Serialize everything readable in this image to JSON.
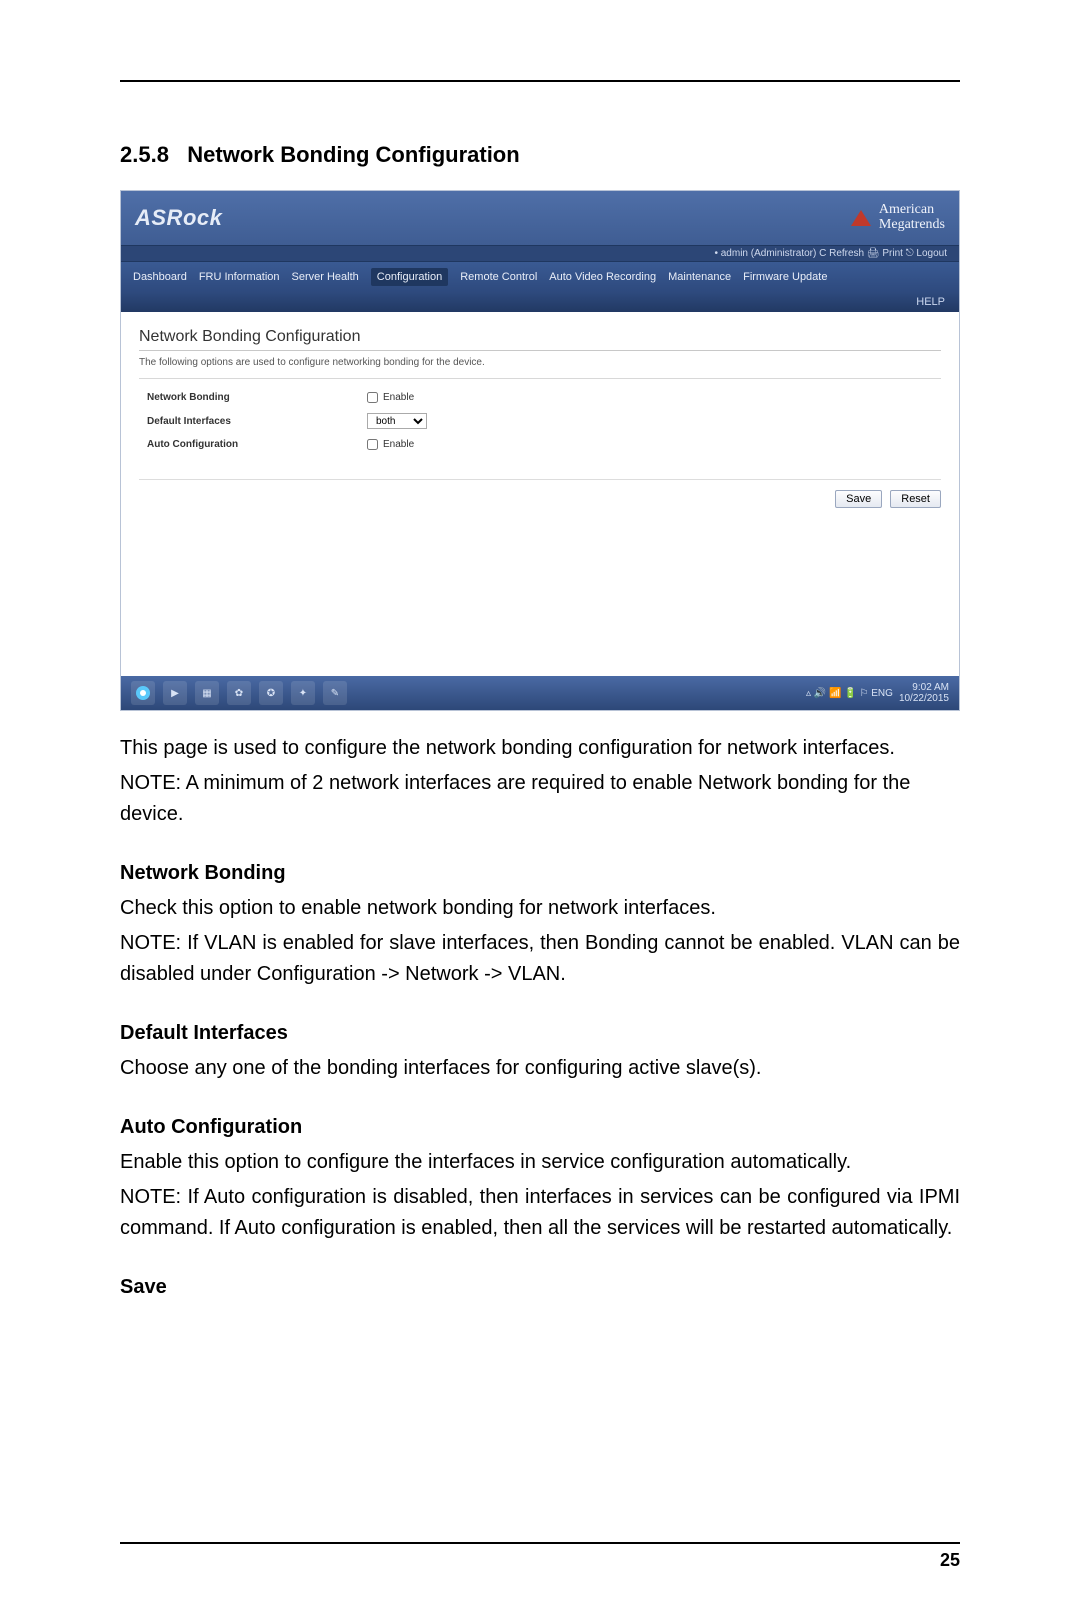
{
  "section": {
    "number": "2.5.8",
    "title": "Network Bonding Configuration"
  },
  "screenshot": {
    "brand": "ASRock",
    "ami_line1": "American",
    "ami_line2": "Megatrends",
    "status_bar": "• admin (Administrator)   C Refresh   🖨 Print   ⎋ Logout",
    "nav": {
      "items": [
        "Dashboard",
        "FRU Information",
        "Server Health",
        "Configuration",
        "Remote Control",
        "Auto Video Recording",
        "Maintenance",
        "Firmware Update"
      ],
      "active_index": 3
    },
    "help_label": "HELP",
    "panel": {
      "title": "Network Bonding Configuration",
      "desc": "The following options are used to configure networking bonding for the device.",
      "rows": {
        "bonding_label": "Network Bonding",
        "bonding_cb_label": "Enable",
        "default_if_label": "Default Interfaces",
        "default_if_value": "both",
        "autoconf_label": "Auto Configuration",
        "autoconf_cb_label": "Enable"
      },
      "buttons": {
        "save": "Save",
        "reset": "Reset"
      }
    },
    "taskbar": {
      "tray": "▵ 🔊 📶 🔋 ⚐ ENG",
      "clock_time": "9:02 AM",
      "clock_date": "10/22/2015"
    }
  },
  "doc": {
    "intro1": "This page is used to configure the network bonding configuration for network interfaces.",
    "intro2": "NOTE: A minimum of 2 network interfaces are required to enable Network bonding for the device.",
    "nb_h": "Network Bonding",
    "nb_p1": "Check this option to enable network bonding for network interfaces.",
    "nb_p2": "NOTE: If VLAN is enabled for slave interfaces, then Bonding cannot be enabled. VLAN can be disabled under Configuration -> Network -> VLAN.",
    "di_h": "Default Interfaces",
    "di_p": "Choose any one of the bonding interfaces for configuring active slave(s).",
    "ac_h": "Auto Configuration",
    "ac_p1": "Enable this option to configure the interfaces in service configuration automatically.",
    "ac_p2": "NOTE: If Auto configuration is disabled, then interfaces in services can be configured via IPMI command. If Auto configuration is enabled, then all the services will be restarted automatically.",
    "save_h": "Save"
  },
  "page_number": "25"
}
